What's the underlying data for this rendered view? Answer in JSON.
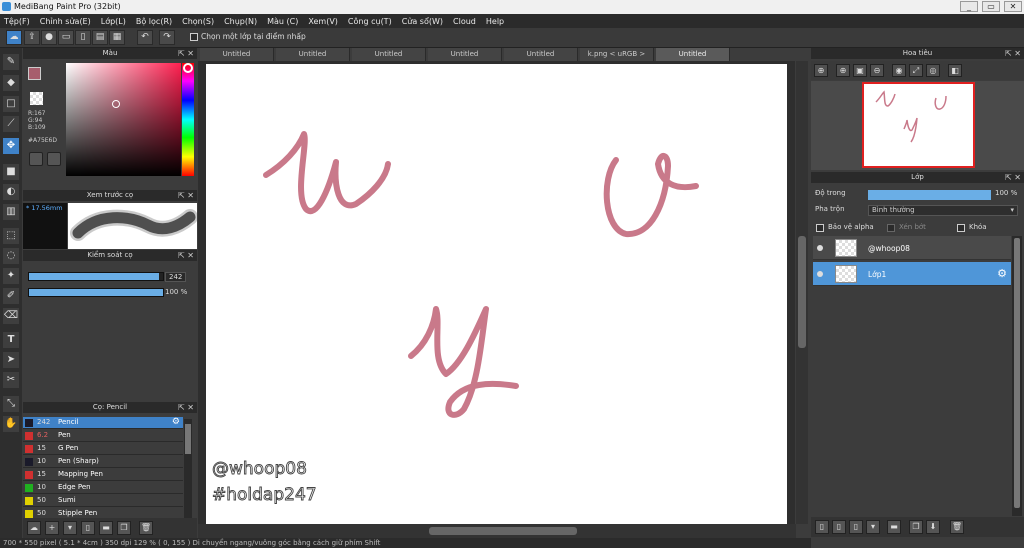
{
  "window": {
    "title": "MediBang Paint Pro (32bit)",
    "minimize": "_",
    "restore": "▭",
    "close": "✕"
  },
  "menu": [
    "Tệp(F)",
    "Chỉnh sửa(E)",
    "Lớp(L)",
    "Bộ lọc(R)",
    "Chọn(S)",
    "Chụp(N)",
    "Màu (C)",
    "Xem(V)",
    "Công cụ(T)",
    "Cửa sổ(W)",
    "Cloud",
    "Help"
  ],
  "toolbar": {
    "snap_label": "Chọn một lớp tại điểm nhấp"
  },
  "color_panel": {
    "title": "Màu",
    "r": "R:167",
    "g": "G:94",
    "b": "B:109",
    "hex": "#A75E6D",
    "fg_color": "#a75e6d"
  },
  "brush_preview": {
    "title": "Xem trước cọ",
    "size": "* 17.56mm"
  },
  "brush_control": {
    "title": "Kiểm soát cọ",
    "size_value": "242",
    "opacity_value": "100 %",
    "size_level": 0.97,
    "opacity_level": 1.0
  },
  "brush_list": {
    "title": "Cọ: Pencil",
    "items": [
      {
        "color": "#1a1a2a",
        "size": "242",
        "name": "Pencil"
      },
      {
        "color": "#d03030",
        "size": "6.2",
        "name": "Pen"
      },
      {
        "color": "#d03030",
        "size": "15",
        "name": "G Pen"
      },
      {
        "color": "#1a1a2a",
        "size": "10",
        "name": "Pen (Sharp)"
      },
      {
        "color": "#d03030",
        "size": "15",
        "name": "Mapping Pen"
      },
      {
        "color": "#20b020",
        "size": "10",
        "name": "Edge Pen"
      },
      {
        "color": "#e0d000",
        "size": "50",
        "name": "Sumi"
      },
      {
        "color": "#e0d000",
        "size": "50",
        "name": "Stipple Pen"
      }
    ]
  },
  "tabs": [
    "Untitled",
    "Untitled",
    "Untitled",
    "Untitled",
    "Untitled",
    "k.png < uRGB >",
    "Untitled"
  ],
  "canvas": {
    "stroke_color": "#c9798a",
    "wm1": "@whoop08",
    "wm2": "#holdap247"
  },
  "navigator": {
    "title": "Hoa tiêu"
  },
  "layer_panel": {
    "title": "Lớp",
    "opacity_label": "Độ trong",
    "opacity_value": "100 %",
    "blend_label": "Pha trộn",
    "blend_value": "Bình thường",
    "protect_alpha": "Bảo vệ alpha",
    "clipping": "Xén bớt",
    "lock": "Khóa",
    "layers": [
      "@whoop08",
      "Lớp1"
    ]
  },
  "status": "700 * 550 pixel   ( 5.1 * 4cm )   350 dpi   129 %   ( 0, 155 )   Di chuyển ngang/vuông góc bằng cách giữ phím Shift"
}
